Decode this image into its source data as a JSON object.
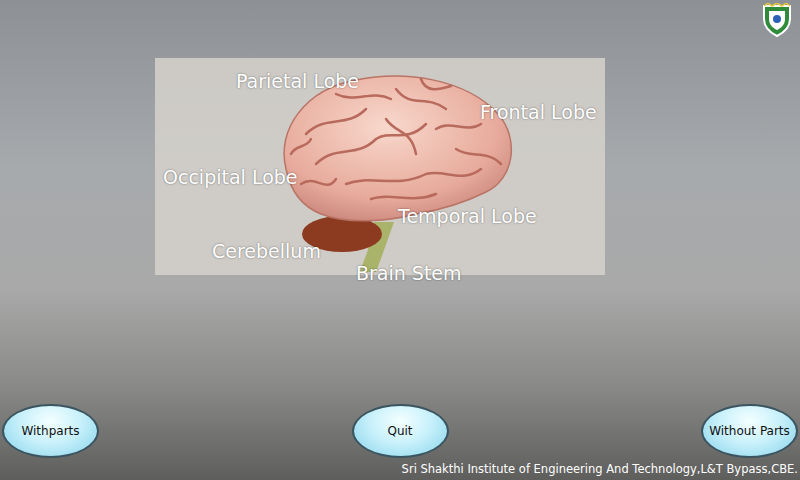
{
  "labels": [
    {
      "text": "Parietal Lobe"
    },
    {
      "text": "Frontal Lobe"
    },
    {
      "text": "Occipital Lobe"
    },
    {
      "text": "Temporal Lobe"
    },
    {
      "text": "Cerebellum"
    },
    {
      "text": "Brain Stem"
    }
  ],
  "buttons": [
    {
      "label": "Withparts"
    },
    {
      "label": "Quit"
    },
    {
      "label": "Without Parts"
    }
  ],
  "footer": "Sri Shakthi Institute of Engineering And Technology,L&T Bypass,CBE."
}
